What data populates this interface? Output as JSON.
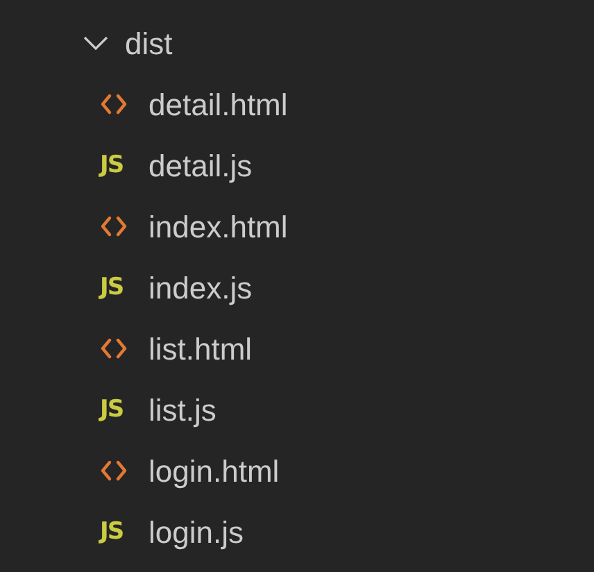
{
  "folder": {
    "name": "dist",
    "expanded": true,
    "children": [
      {
        "kind": "html",
        "name": "detail.html"
      },
      {
        "kind": "js",
        "icon_label": "JS",
        "name": "detail.js"
      },
      {
        "kind": "html",
        "name": "index.html"
      },
      {
        "kind": "js",
        "icon_label": "JS",
        "name": "index.js"
      },
      {
        "kind": "html",
        "name": "list.html"
      },
      {
        "kind": "js",
        "icon_label": "JS",
        "name": "list.js"
      },
      {
        "kind": "html",
        "name": "login.html"
      },
      {
        "kind": "js",
        "icon_label": "JS",
        "name": "login.js"
      }
    ]
  }
}
